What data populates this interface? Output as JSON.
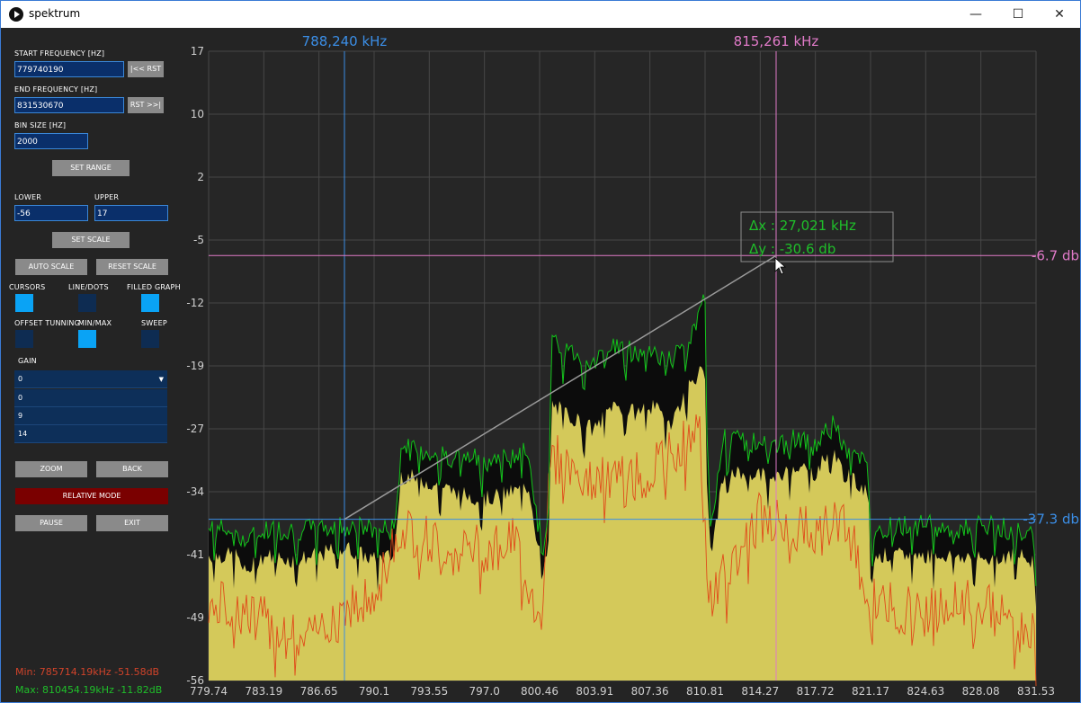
{
  "window": {
    "title": "spektrum",
    "controls": [
      "—",
      "☐",
      "✕"
    ]
  },
  "panel": {
    "start_freq_label": "START FREQUENCY [HZ]",
    "start_freq_value": "779740190",
    "rst_left": "|<< RST",
    "end_freq_label": "END FREQUENCY [HZ]",
    "end_freq_value": "831530670",
    "rst_right": "RST >>|",
    "bin_label": "BIN SIZE [HZ]",
    "bin_value": "2000",
    "set_range": "SET RANGE",
    "lower_label": "LOWER",
    "lower_value": "-56",
    "upper_label": "UPPER",
    "upper_value": "17",
    "set_scale": "SET SCALE",
    "auto_scale": "AUTO SCALE",
    "reset_scale": "RESET SCALE",
    "cursors_label": "CURSORS",
    "cursors_on": true,
    "line_dots_label": "LINE/DOTS",
    "line_dots_on": false,
    "filled_label": "FILLED GRAPH",
    "filled_on": true,
    "offset_label": "OFFSET TUNNING",
    "offset_on": false,
    "minmax_label": "MIN/MAX",
    "minmax_on": true,
    "sweep_label": "SWEEP",
    "sweep_on": false,
    "gain_label": "GAIN",
    "gain_selected": "0",
    "gain_options": [
      "0",
      "9",
      "14"
    ],
    "zoom": "ZOOM",
    "back": "BACK",
    "relative_mode": "RELATIVE MODE",
    "pause": "PAUSE",
    "exit": "EXIT",
    "min_readout": "Min: 785714.19kHz -51.58dB",
    "max_readout": "Max: 810454.19kHz -11.82dB"
  },
  "colors": {
    "fill": "#d4c95a",
    "max_line": "#12c41a",
    "min_line": "#e04b1a",
    "cursor_blue": "#3b8ee6",
    "cursor_pink": "#e07ac8",
    "panel_button": "#8a8a8a",
    "relative_mode": "#7a0000"
  },
  "chart_data": {
    "type": "area",
    "xlim": [
      779.74,
      831.53
    ],
    "ylim": [
      -56,
      17
    ],
    "grid": true,
    "x_ticks": [
      "779.74",
      "783.19",
      "786.65",
      "790.1",
      "793.55",
      "797.0",
      "800.46",
      "803.91",
      "807.36",
      "810.81",
      "814.27",
      "817.72",
      "821.17",
      "824.63",
      "828.08",
      "831.53"
    ],
    "y_ticks": [
      "17",
      "10",
      "2",
      "-5",
      "-12",
      "-19",
      "-27",
      "-34",
      "-41",
      "-49",
      "-56"
    ],
    "series": [
      {
        "role": "current_fill",
        "x": [
          779.74,
          781.5,
          782.0,
          783.2,
          785.0,
          786.6,
          788.2,
          790.1,
          791.4,
          791.6,
          793.5,
          795.0,
          797.0,
          799.0,
          799.8,
          800.4,
          801.0,
          801.2,
          803.9,
          805.0,
          806.5,
          807.3,
          808.7,
          810.0,
          810.8,
          811.1,
          812.0,
          814.2,
          815.0,
          816.5,
          817.7,
          818.7,
          819.5,
          821.0,
          821.2,
          823.0,
          824.6,
          826.5,
          828.0,
          830.0,
          831.3,
          831.53
        ],
        "y": [
          -41.5,
          -41.5,
          -43.5,
          -41.5,
          -42,
          -41.5,
          -40.5,
          -42,
          -41.5,
          -32,
          -33,
          -34,
          -35,
          -34,
          -33.5,
          -41,
          -42,
          -24,
          -27,
          -24,
          -25,
          -24,
          -26,
          -21,
          -20,
          -42,
          -32,
          -32,
          -33,
          -31,
          -32,
          -29,
          -32,
          -34,
          -41.5,
          -41.5,
          -41.5,
          -41.5,
          -42,
          -41.5,
          -42,
          -44
        ]
      },
      {
        "role": "max_hold",
        "x": [
          779.74,
          781.5,
          782.0,
          783.2,
          785.0,
          786.6,
          788.2,
          790.1,
          791.4,
          791.6,
          793.5,
          795.0,
          797.0,
          799.0,
          799.8,
          800.4,
          801.0,
          801.2,
          803.9,
          805.0,
          806.5,
          807.3,
          808.7,
          810.0,
          810.8,
          811.1,
          812.0,
          814.2,
          815.0,
          816.5,
          817.7,
          818.7,
          819.5,
          821.0,
          821.2,
          823.0,
          824.6,
          826.5,
          828.0,
          830.0,
          831.3,
          831.53
        ],
        "y": [
          -38.5,
          -38.5,
          -40,
          -38.5,
          -38.5,
          -38.5,
          -38,
          -38.5,
          -38.5,
          -29,
          -29.5,
          -30,
          -30.5,
          -30,
          -29.5,
          -38.5,
          -38.5,
          -17,
          -19,
          -17,
          -18,
          -17.5,
          -19,
          -16,
          -12,
          -38,
          -28,
          -28.5,
          -29,
          -28,
          -29,
          -25.5,
          -29,
          -31,
          -38.5,
          -38,
          -38,
          -38.5,
          -38,
          -38.5,
          -38.5,
          -41
        ]
      },
      {
        "role": "min_hold",
        "x": [
          779.74,
          782.0,
          785.714,
          788.2,
          790.1,
          791.6,
          795.0,
          799.0,
          800.4,
          801.2,
          804.0,
          807.3,
          810.454,
          811.1,
          814.2,
          817.7,
          819.5,
          821.2,
          824.6,
          828.0,
          831.53
        ],
        "y": [
          -47,
          -48,
          -51.58,
          -47,
          -47,
          -38,
          -41,
          -40,
          -49,
          -30,
          -33,
          -32,
          -27,
          -47,
          -37,
          -39,
          -37,
          -47,
          -48,
          -47,
          -51
        ]
      }
    ],
    "cursors": {
      "v1": {
        "label": "788,240 kHz",
        "x": 788.24
      },
      "v2": {
        "label": "815,261 kHz",
        "x": 815.261
      },
      "h1": {
        "label": "-6.7 db",
        "y": -6.7
      },
      "h2": {
        "label": "-37.3 db",
        "y": -37.3
      }
    },
    "delta": {
      "dx": "Δx : 27,021 kHz",
      "dy": "Δy : -30.6 db"
    }
  }
}
